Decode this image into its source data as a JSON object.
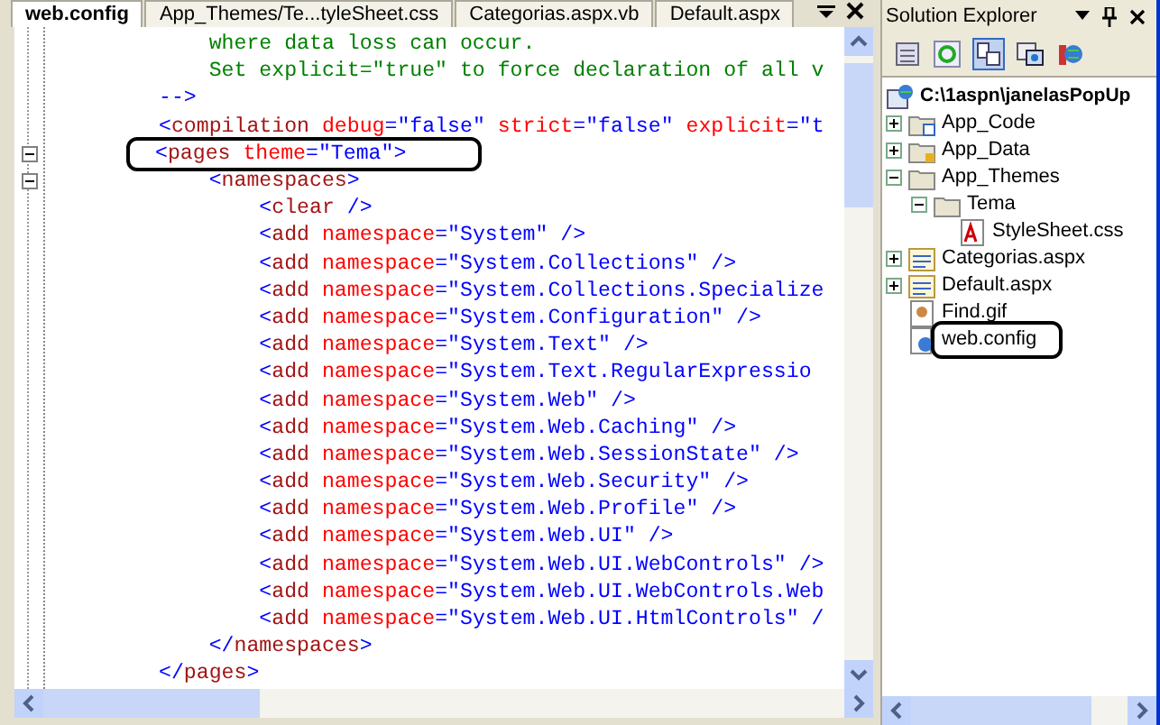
{
  "editor": {
    "tabs": [
      {
        "label": "web.config",
        "selected": true
      },
      {
        "label": "App_Themes/Te...tyleSheet.css",
        "selected": false
      },
      {
        "label": "Categorias.aspx.vb",
        "selected": false
      },
      {
        "label": "Default.aspx",
        "selected": false
      }
    ],
    "lines": [
      {
        "fold": false,
        "highlighted": false,
        "tokens": [
          {
            "kind": "comment",
            "text": "    where data loss can occur."
          }
        ]
      },
      {
        "fold": false,
        "highlighted": false,
        "tokens": [
          {
            "kind": "comment",
            "text": "    Set explicit=\"true\" to force declaration of all v"
          }
        ]
      },
      {
        "fold": false,
        "highlighted": false,
        "tokens": [
          {
            "kind": "punct",
            "text": "-->"
          }
        ]
      },
      {
        "fold": false,
        "highlighted": false,
        "tokens": [
          {
            "kind": "punct",
            "text": "<"
          },
          {
            "kind": "tag",
            "text": "compilation"
          },
          {
            "kind": "attr",
            "text": " debug"
          },
          {
            "kind": "punct",
            "text": "=\"false\""
          },
          {
            "kind": "attr",
            "text": " strict"
          },
          {
            "kind": "punct",
            "text": "=\"false\""
          },
          {
            "kind": "attr",
            "text": " explicit"
          },
          {
            "kind": "punct",
            "text": "=\"t"
          }
        ]
      },
      {
        "fold": true,
        "highlighted": true,
        "tokens": [
          {
            "kind": "punct",
            "text": "<"
          },
          {
            "kind": "tag",
            "text": "pages"
          },
          {
            "kind": "attr",
            "text": " theme"
          },
          {
            "kind": "punct",
            "text": "=\"Tema\">"
          }
        ]
      },
      {
        "fold": true,
        "highlighted": false,
        "tokens": [
          {
            "kind": "punct",
            "text": "    <"
          },
          {
            "kind": "tag",
            "text": "namespaces"
          },
          {
            "kind": "punct",
            "text": ">"
          }
        ]
      },
      {
        "fold": false,
        "highlighted": false,
        "tokens": [
          {
            "kind": "punct",
            "text": "        <"
          },
          {
            "kind": "tag",
            "text": "clear"
          },
          {
            "kind": "punct",
            "text": " />"
          }
        ]
      },
      {
        "fold": false,
        "highlighted": false,
        "tokens": [
          {
            "kind": "punct",
            "text": "        <"
          },
          {
            "kind": "tag",
            "text": "add"
          },
          {
            "kind": "attr",
            "text": " namespace"
          },
          {
            "kind": "punct",
            "text": "=\"System\" />"
          }
        ]
      },
      {
        "fold": false,
        "highlighted": false,
        "tokens": [
          {
            "kind": "punct",
            "text": "        <"
          },
          {
            "kind": "tag",
            "text": "add"
          },
          {
            "kind": "attr",
            "text": " namespace"
          },
          {
            "kind": "punct",
            "text": "=\"System.Collections\" />"
          }
        ]
      },
      {
        "fold": false,
        "highlighted": false,
        "tokens": [
          {
            "kind": "punct",
            "text": "        <"
          },
          {
            "kind": "tag",
            "text": "add"
          },
          {
            "kind": "attr",
            "text": " namespace"
          },
          {
            "kind": "punct",
            "text": "=\"System.Collections.Specialize"
          }
        ]
      },
      {
        "fold": false,
        "highlighted": false,
        "tokens": [
          {
            "kind": "punct",
            "text": "        <"
          },
          {
            "kind": "tag",
            "text": "add"
          },
          {
            "kind": "attr",
            "text": " namespace"
          },
          {
            "kind": "punct",
            "text": "=\"System.Configuration\" />"
          }
        ]
      },
      {
        "fold": false,
        "highlighted": false,
        "tokens": [
          {
            "kind": "punct",
            "text": "        <"
          },
          {
            "kind": "tag",
            "text": "add"
          },
          {
            "kind": "attr",
            "text": " namespace"
          },
          {
            "kind": "punct",
            "text": "=\"System.Text\" />"
          }
        ]
      },
      {
        "fold": false,
        "highlighted": false,
        "tokens": [
          {
            "kind": "punct",
            "text": "        <"
          },
          {
            "kind": "tag",
            "text": "add"
          },
          {
            "kind": "attr",
            "text": " namespace"
          },
          {
            "kind": "punct",
            "text": "=\"System.Text.RegularExpressio"
          }
        ]
      },
      {
        "fold": false,
        "highlighted": false,
        "tokens": [
          {
            "kind": "punct",
            "text": "        <"
          },
          {
            "kind": "tag",
            "text": "add"
          },
          {
            "kind": "attr",
            "text": " namespace"
          },
          {
            "kind": "punct",
            "text": "=\"System.Web\" />"
          }
        ]
      },
      {
        "fold": false,
        "highlighted": false,
        "tokens": [
          {
            "kind": "punct",
            "text": "        <"
          },
          {
            "kind": "tag",
            "text": "add"
          },
          {
            "kind": "attr",
            "text": " namespace"
          },
          {
            "kind": "punct",
            "text": "=\"System.Web.Caching\" />"
          }
        ]
      },
      {
        "fold": false,
        "highlighted": false,
        "tokens": [
          {
            "kind": "punct",
            "text": "        <"
          },
          {
            "kind": "tag",
            "text": "add"
          },
          {
            "kind": "attr",
            "text": " namespace"
          },
          {
            "kind": "punct",
            "text": "=\"System.Web.SessionState\" />"
          }
        ]
      },
      {
        "fold": false,
        "highlighted": false,
        "tokens": [
          {
            "kind": "punct",
            "text": "        <"
          },
          {
            "kind": "tag",
            "text": "add"
          },
          {
            "kind": "attr",
            "text": " namespace"
          },
          {
            "kind": "punct",
            "text": "=\"System.Web.Security\" />"
          }
        ]
      },
      {
        "fold": false,
        "highlighted": false,
        "tokens": [
          {
            "kind": "punct",
            "text": "        <"
          },
          {
            "kind": "tag",
            "text": "add"
          },
          {
            "kind": "attr",
            "text": " namespace"
          },
          {
            "kind": "punct",
            "text": "=\"System.Web.Profile\" />"
          }
        ]
      },
      {
        "fold": false,
        "highlighted": false,
        "tokens": [
          {
            "kind": "punct",
            "text": "        <"
          },
          {
            "kind": "tag",
            "text": "add"
          },
          {
            "kind": "attr",
            "text": " namespace"
          },
          {
            "kind": "punct",
            "text": "=\"System.Web.UI\" />"
          }
        ]
      },
      {
        "fold": false,
        "highlighted": false,
        "tokens": [
          {
            "kind": "punct",
            "text": "        <"
          },
          {
            "kind": "tag",
            "text": "add"
          },
          {
            "kind": "attr",
            "text": " namespace"
          },
          {
            "kind": "punct",
            "text": "=\"System.Web.UI.WebControls\" />"
          }
        ]
      },
      {
        "fold": false,
        "highlighted": false,
        "tokens": [
          {
            "kind": "punct",
            "text": "        <"
          },
          {
            "kind": "tag",
            "text": "add"
          },
          {
            "kind": "attr",
            "text": " namespace"
          },
          {
            "kind": "punct",
            "text": "=\"System.Web.UI.WebControls.Web"
          }
        ]
      },
      {
        "fold": false,
        "highlighted": false,
        "tokens": [
          {
            "kind": "punct",
            "text": "        <"
          },
          {
            "kind": "tag",
            "text": "add"
          },
          {
            "kind": "attr",
            "text": " namespace"
          },
          {
            "kind": "punct",
            "text": "=\"System.Web.UI.HtmlControls\" /"
          }
        ]
      },
      {
        "fold": false,
        "highlighted": false,
        "tokens": [
          {
            "kind": "punct",
            "text": "    </"
          },
          {
            "kind": "tag",
            "text": "namespaces"
          },
          {
            "kind": "punct",
            "text": ">"
          }
        ]
      },
      {
        "fold": false,
        "highlighted": false,
        "tokens": [
          {
            "kind": "punct",
            "text": "</"
          },
          {
            "kind": "tag",
            "text": "pages"
          },
          {
            "kind": "punct",
            "text": ">"
          }
        ]
      }
    ]
  },
  "solution_explorer": {
    "title": "Solution Explorer",
    "root": {
      "label": "C:\\1aspn\\janelasPopUp",
      "children": [
        {
          "label": "App_Code",
          "kind": "folder-code",
          "expanded": false,
          "highlighted": false
        },
        {
          "label": "App_Data",
          "kind": "folder-data",
          "expanded": false,
          "highlighted": false
        },
        {
          "label": "App_Themes",
          "kind": "folder",
          "expanded": true,
          "highlighted": false,
          "children": [
            {
              "label": "Tema",
              "kind": "folder",
              "expanded": true,
              "highlighted": false,
              "children": [
                {
                  "label": "StyleSheet.css",
                  "kind": "css",
                  "highlighted": false
                }
              ]
            }
          ]
        },
        {
          "label": "Categorias.aspx",
          "kind": "page",
          "expanded": false,
          "highlighted": false
        },
        {
          "label": "Default.aspx",
          "kind": "page",
          "expanded": false,
          "highlighted": false
        },
        {
          "label": "Find.gif",
          "kind": "image",
          "highlighted": false
        },
        {
          "label": "web.config",
          "kind": "config",
          "highlighted": true
        }
      ]
    }
  }
}
